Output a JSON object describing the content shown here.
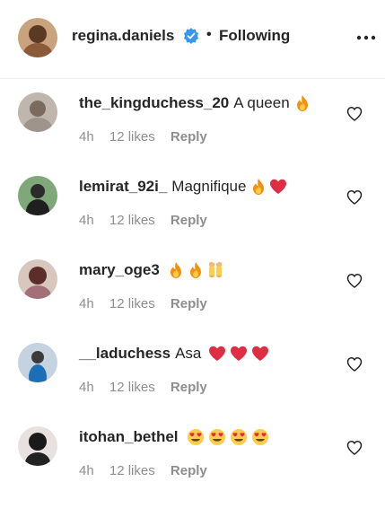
{
  "header": {
    "username": "regina.daniels",
    "separator": "•",
    "follow_status": "Following",
    "avatar_icon": "avatar-photo",
    "verified_icon": "verified-badge-icon",
    "more_icon": "more-options-icon"
  },
  "colors": {
    "text": "#262626",
    "meta": "#8e8e8e",
    "verified": "#3897f0"
  },
  "comments": [
    {
      "username": "the_kingduchess_20",
      "text": "A queen",
      "emojis": [
        "fire"
      ],
      "time": "4h",
      "likes": "12 likes",
      "reply": "Reply"
    },
    {
      "username": "lemirat_92i_",
      "text": "Magnifique",
      "emojis": [
        "fire",
        "red-heart"
      ],
      "time": "4h",
      "likes": "12 likes",
      "reply": "Reply"
    },
    {
      "username": "mary_oge3",
      "text": "",
      "emojis": [
        "fire",
        "fire",
        "raising-hands"
      ],
      "time": "4h",
      "likes": "12 likes",
      "reply": "Reply"
    },
    {
      "username": "__laduchess",
      "text": "Asa",
      "emojis": [
        "red-heart",
        "red-heart",
        "red-heart"
      ],
      "time": "4h",
      "likes": "12 likes",
      "reply": "Reply"
    },
    {
      "username": "itohan_bethel",
      "text": "",
      "emojis": [
        "heart-eyes",
        "heart-eyes",
        "heart-eyes",
        "heart-eyes"
      ],
      "time": "4h",
      "likes": "12 likes",
      "reply": "Reply"
    }
  ]
}
